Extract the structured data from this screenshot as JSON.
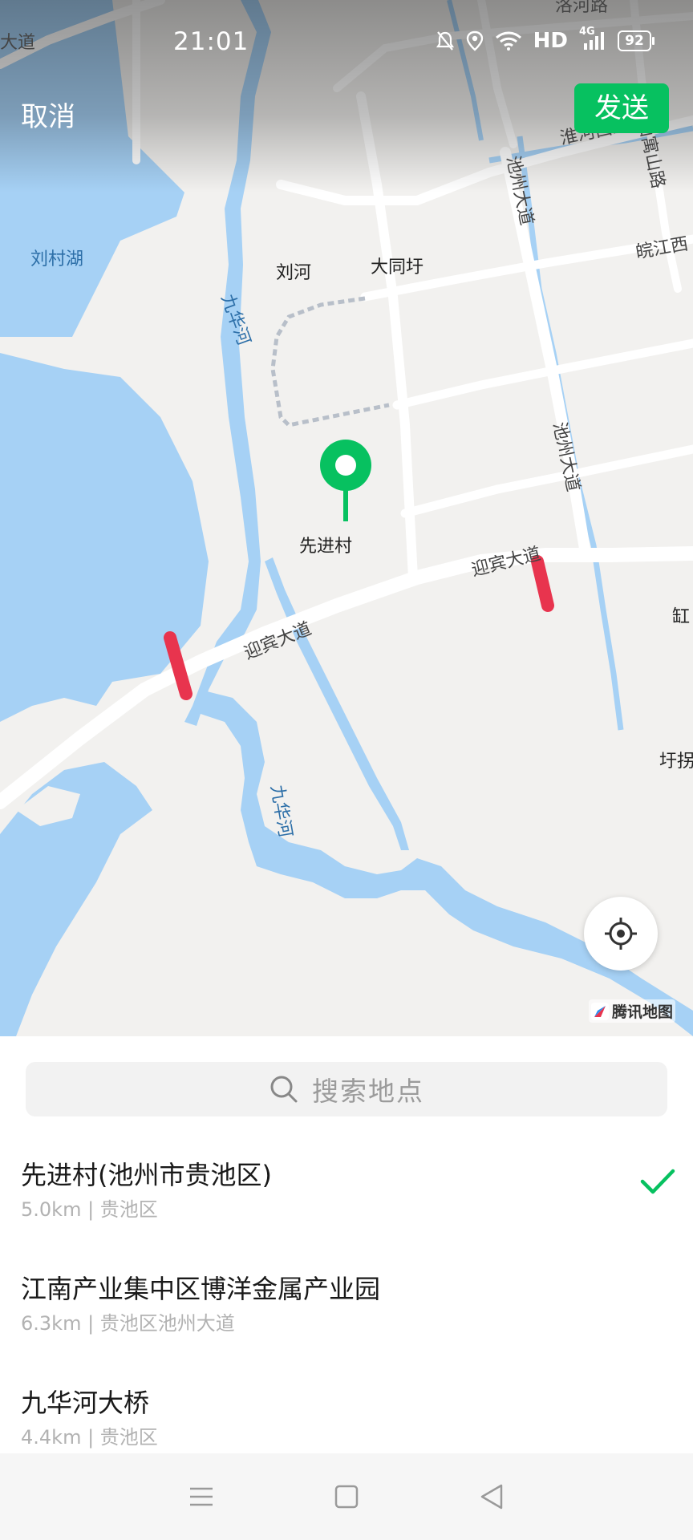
{
  "status_bar": {
    "time": "21:01",
    "network_label": "HD",
    "signal_label": "4G",
    "battery_percent": "92",
    "icons": [
      "mute-bell-icon",
      "location-icon",
      "wifi-icon",
      "signal-icon",
      "battery-icon"
    ]
  },
  "header": {
    "cancel_label": "取消",
    "send_label": "发送"
  },
  "map": {
    "provider_label": "腾讯地图",
    "selected_marker_label": "先进村",
    "place_labels": {
      "liucun_lake": "刘村湖",
      "liuhe": "刘河",
      "datongyu": "大同圩",
      "xianjincun": "先进村",
      "gang": "缸",
      "yubai": "圩拐"
    },
    "road_labels": {
      "luohe_road": "洛河路",
      "top_left_avenue": "大道",
      "huaihe_west_road": "淮河西路",
      "xianyu_mountain_road": "仙寓山路",
      "wanjiang_west": "皖江西",
      "chizhou_avenue_1": "池州大道",
      "chizhou_avenue_2": "池州大道",
      "yingbin_avenue_1": "迎宾大道",
      "yingbin_avenue_2": "迎宾大道"
    },
    "river_labels": {
      "jiuhua_river_1": "九华河",
      "jiuhua_river_2": "九华河"
    },
    "colors": {
      "water": "#a6d1f5",
      "land": "#f2f1ef",
      "road": "#ffffff",
      "marker": "#07c160",
      "congestion": "#e8344e"
    }
  },
  "search": {
    "placeholder": "搜索地点"
  },
  "results": [
    {
      "title": "先进村(池州市贵池区)",
      "subtitle": "5.0km | 贵池区",
      "selected": true
    },
    {
      "title": "江南产业集中区博洋金属产业园",
      "subtitle": "6.3km | 贵池区池州大道",
      "selected": false
    },
    {
      "title": "九华河大桥",
      "subtitle": "4.4km | 贵池区",
      "selected": false
    }
  ],
  "accent_color": "#07c160",
  "nav_bar": {
    "icons": [
      "menu-icon",
      "home-square-icon",
      "back-triangle-icon"
    ]
  }
}
